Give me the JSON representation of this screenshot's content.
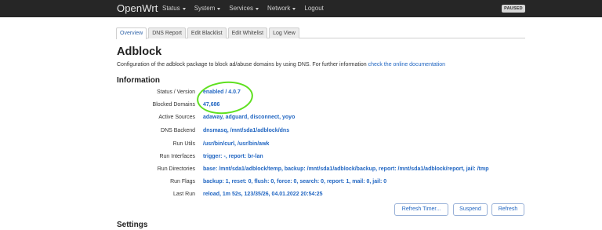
{
  "navbar": {
    "brand": "OpenWrt",
    "menu": [
      {
        "label": "Status",
        "dropdown": true
      },
      {
        "label": "System",
        "dropdown": true
      },
      {
        "label": "Services",
        "dropdown": true
      },
      {
        "label": "Network",
        "dropdown": true
      },
      {
        "label": "Logout",
        "dropdown": false
      }
    ],
    "badge": "PAUSED"
  },
  "tabs": [
    {
      "label": "Overview",
      "active": true
    },
    {
      "label": "DNS Report",
      "active": false
    },
    {
      "label": "Edit Blacklist",
      "active": false
    },
    {
      "label": "Edit Whitelist",
      "active": false
    },
    {
      "label": "Log View",
      "active": false
    }
  ],
  "page": {
    "title": "Adblock",
    "description": "Configuration of the adblock package to block ad/abuse domains by using DNS. For further information ",
    "doc_link": "check the online documentation"
  },
  "information": {
    "title": "Information",
    "rows": [
      {
        "label": "Status / Version",
        "value": "enabled / 4.0.7"
      },
      {
        "label": "Blocked Domains",
        "value": "47,686"
      },
      {
        "label": "Active Sources",
        "value": "adaway, adguard, disconnect, yoyo"
      },
      {
        "label": "DNS Backend",
        "value": "dnsmasq, /mnt/sda1/adblock/dns"
      },
      {
        "label": "Run Utils",
        "value": "/usr/bin/curl, /usr/bin/awk"
      },
      {
        "label": "Run Interfaces",
        "value": "trigger: -, report: br-lan"
      },
      {
        "label": "Run Directories",
        "value": "base: /mnt/sda1/adblock/temp, backup: /mnt/sda1/adblock/backup, report: /mnt/sda1/adblock/report, jail: /tmp"
      },
      {
        "label": "Run Flags",
        "value": "backup: 1, reset: 0, flush: 0, force: 0, search: 0, report: 1, mail: 0, jail: 0"
      },
      {
        "label": "Last Run",
        "value": "reload, 1m 52s, 123/35/26, 04.01.2022 20:54:25"
      }
    ]
  },
  "buttons": {
    "refresh_timer": "Refresh Timer...",
    "suspend": "Suspend",
    "refresh": "Refresh"
  },
  "settings": {
    "title": "Settings"
  },
  "colors": {
    "navbar_bg": "#262626",
    "link": "#2166c2",
    "highlight_ring": "#5ee01f"
  }
}
